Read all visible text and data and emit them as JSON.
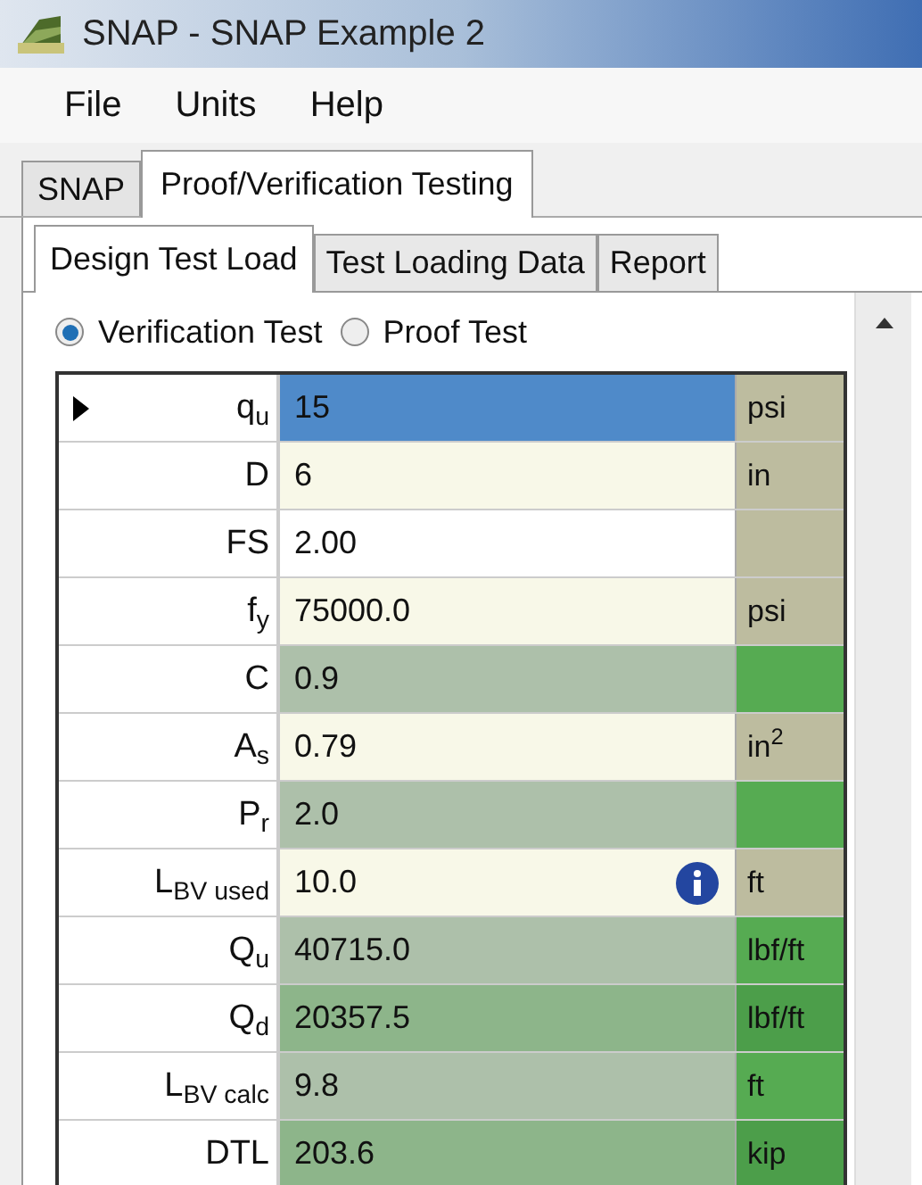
{
  "window": {
    "title": "SNAP - SNAP Example 2"
  },
  "menu": [
    "File",
    "Units",
    "Help"
  ],
  "tabs": [
    {
      "label": "SNAP",
      "selected": false
    },
    {
      "label": "Proof/Verification Testing",
      "selected": true
    }
  ],
  "subtabs": [
    {
      "label": "Design Test Load",
      "selected": true
    },
    {
      "label": "Test Loading Data",
      "selected": false
    },
    {
      "label": "Report",
      "selected": false
    }
  ],
  "test_type": [
    {
      "label": "Verification Test",
      "selected": true
    },
    {
      "label": "Proof Test",
      "selected": false
    }
  ],
  "grid": {
    "rows": [
      {
        "label": "q$_{u}$",
        "value": "15",
        "unit": "psi",
        "kind": "input",
        "selected": true,
        "info": false
      },
      {
        "label": "D",
        "value": "6",
        "unit": "in",
        "kind": "input",
        "selected": false,
        "info": false
      },
      {
        "label": "FS",
        "value": "2.00",
        "kind": "default",
        "selected": false,
        "info": false
      },
      {
        "label": "f$_{y}$",
        "value": "75000.0",
        "unit": "psi",
        "kind": "input",
        "selected": false,
        "info": false
      },
      {
        "label": "C",
        "value": "0.9",
        "kind": "computed",
        "selected": false,
        "info": false
      },
      {
        "label": "A$_{s}$",
        "value": "0.79",
        "unit": "in$^{2}$",
        "kind": "input",
        "selected": false,
        "info": false
      },
      {
        "label": "P$_{r}$",
        "value": "2.0",
        "kind": "computed",
        "selected": false,
        "info": false
      },
      {
        "label": "L$_{BV used}$",
        "value": "10.0",
        "unit": "ft",
        "kind": "input",
        "selected": false,
        "info": true
      },
      {
        "label": "Q$_{u}$",
        "value": "40715.0",
        "unit": "lbf/ft",
        "kind": "computed",
        "selected": false,
        "info": false
      },
      {
        "label": "Q$_{d}$",
        "value": "20357.5",
        "unit": "lbf/ft",
        "kind": "result",
        "selected": false,
        "info": false
      },
      {
        "label": "L$_{BV calc}$",
        "value": "9.8",
        "unit": "ft",
        "kind": "computed",
        "selected": false,
        "info": false
      },
      {
        "label": "DTL",
        "value": "203.6",
        "unit": "kip",
        "kind": "result",
        "selected": false,
        "info": false
      }
    ]
  }
}
